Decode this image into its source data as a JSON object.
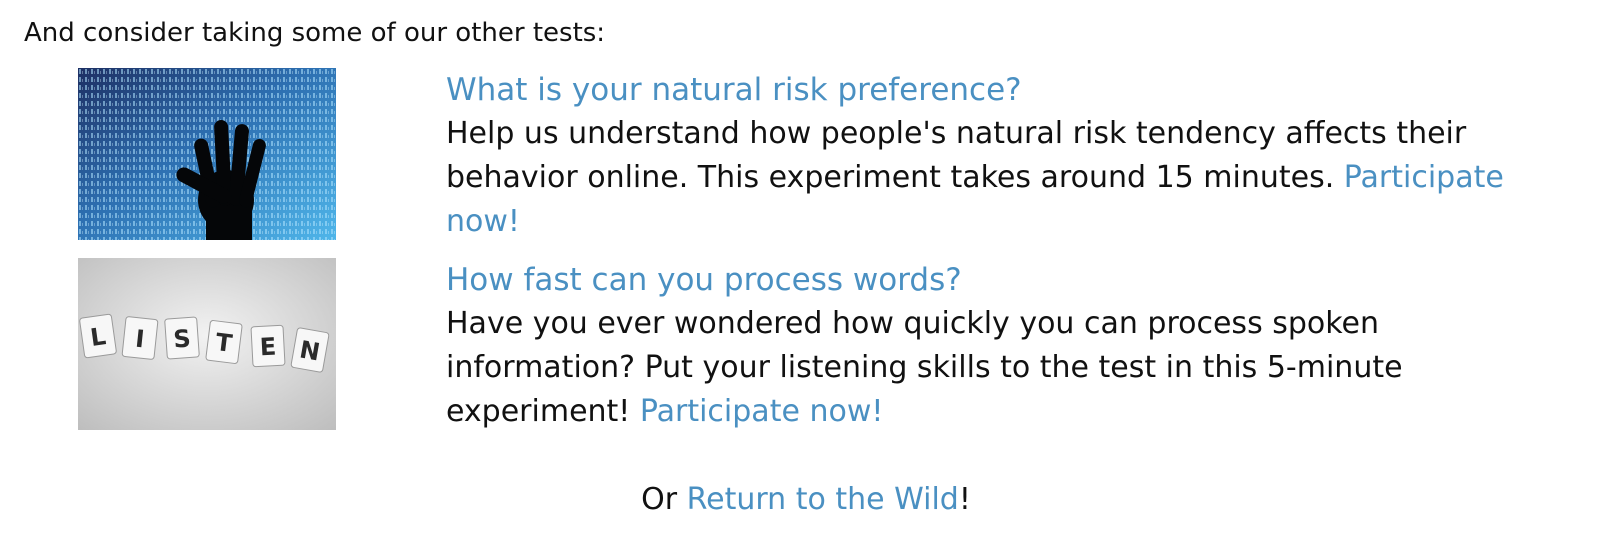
{
  "intro": "And consider taking some of our other tests:",
  "tests": [
    {
      "image_alt": "hand-on-binary-code-image",
      "title": "What is your natural risk preference?",
      "description": "Help us understand how people's natural risk tendency affects their behavior online. This experiment takes around 15 minutes. ",
      "cta": "Participate now!"
    },
    {
      "image_alt": "listen-letter-tiles-image",
      "title": "How fast can you process words?",
      "description": "Have you ever wondered how quickly you can process spoken information? Put your listening skills to the test in this 5-minute experiment! ",
      "cta": "Participate now!"
    }
  ],
  "tiles": [
    "L",
    "I",
    "S",
    "T",
    "E",
    "N"
  ],
  "footer": {
    "prefix": "Or ",
    "link": "Return to the Wild",
    "suffix": "!"
  },
  "colors": {
    "link": "#4a90c2",
    "text": "#111111"
  }
}
